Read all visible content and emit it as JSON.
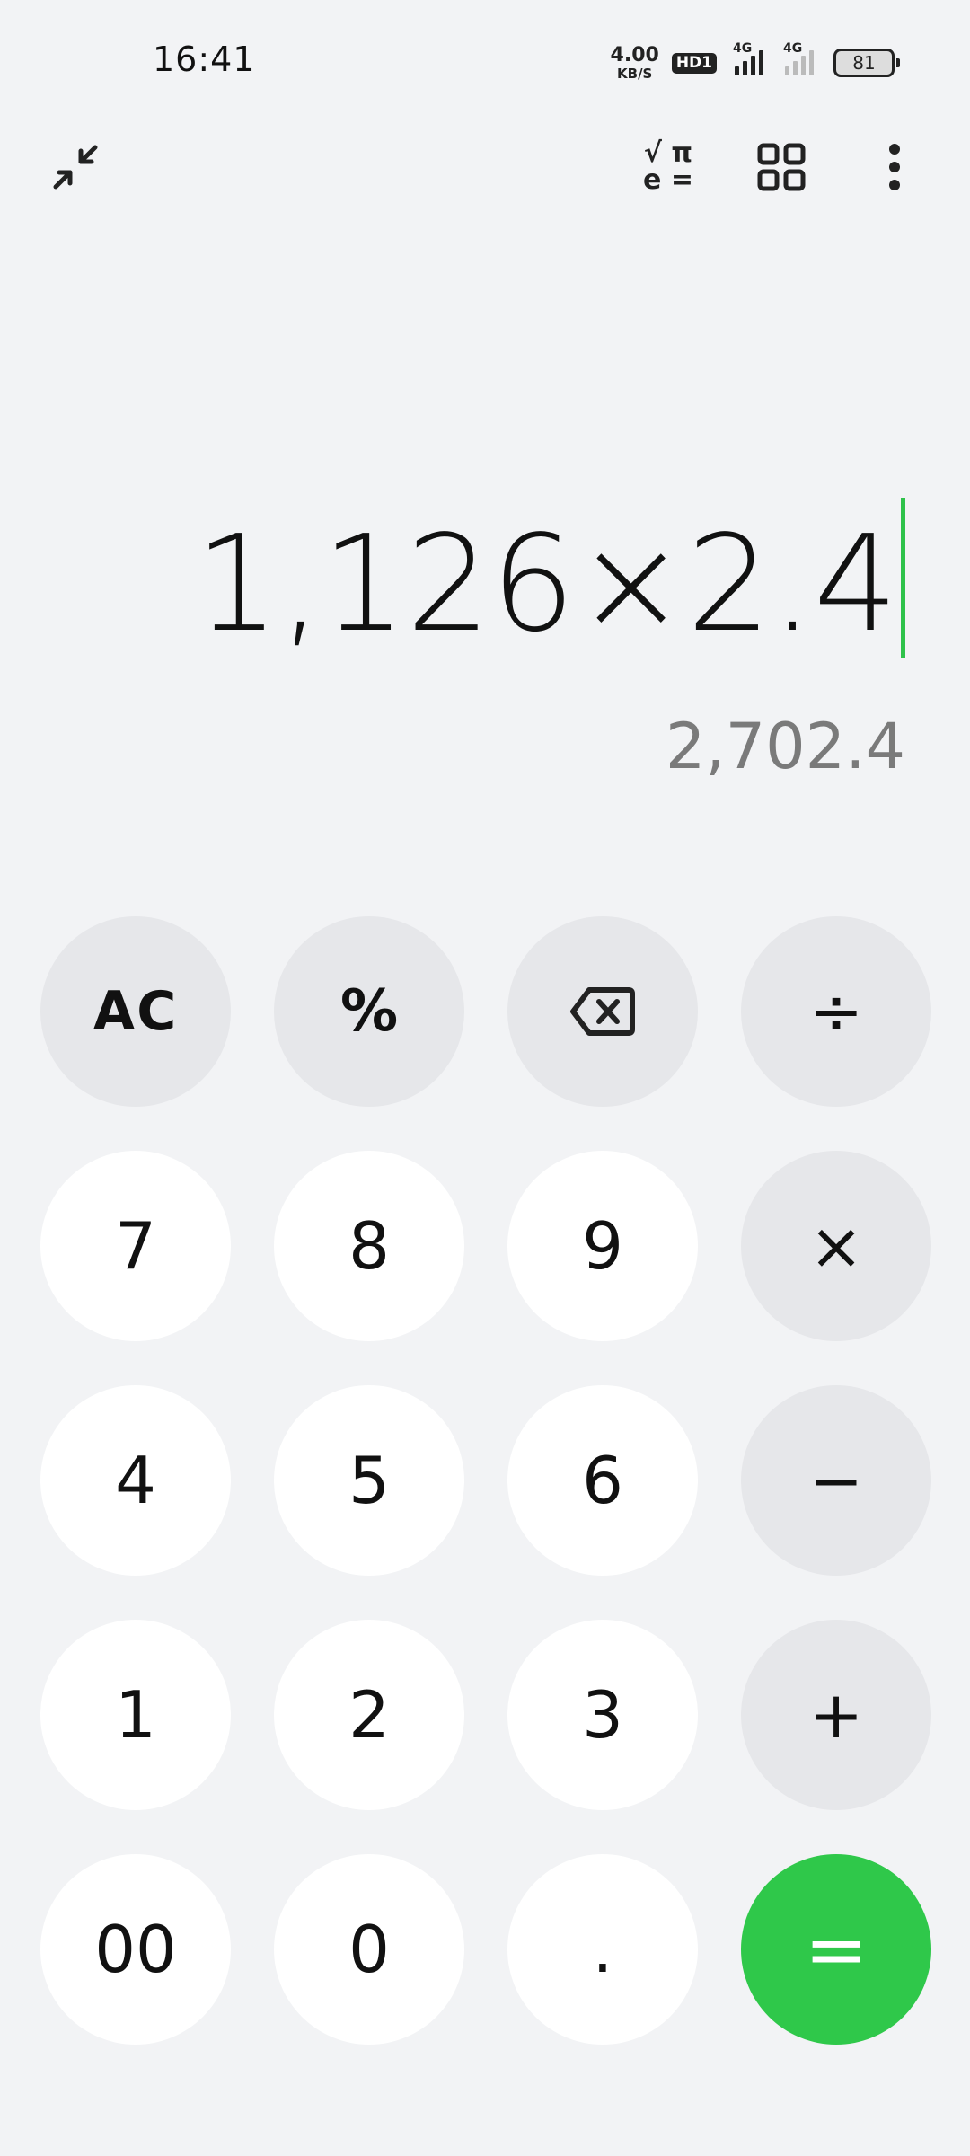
{
  "status_bar": {
    "time": "16:41",
    "net_speed_value": "4.00",
    "net_speed_unit": "KB/S",
    "hd_label": "HD1",
    "sim1_label": "4G",
    "sim2_label": "4G",
    "battery_level": "81"
  },
  "toolbar": {
    "collapse_icon": "collapse-arrows-icon",
    "scientific_icon": "scientific-functions-icon",
    "scientific_top": "√ π",
    "scientific_bottom": "e =",
    "apps_icon": "grid-icon",
    "more_icon": "more-vertical-icon"
  },
  "display": {
    "expression": "1,126×2.4",
    "result": "2,702.4"
  },
  "keypad": {
    "ac": "AC",
    "percent": "%",
    "backspace_icon": "backspace-icon",
    "divide": "÷",
    "seven": "7",
    "eight": "8",
    "nine": "9",
    "multiply": "×",
    "four": "4",
    "five": "5",
    "six": "6",
    "minus": "−",
    "one": "1",
    "two": "2",
    "three": "3",
    "plus": "+",
    "double_zero": "00",
    "zero": "0",
    "decimal": ".",
    "equals": "="
  },
  "colors": {
    "background": "#f2f3f5",
    "accent": "#2fc84a",
    "function_key": "#e6e7ea",
    "number_key": "#ffffff",
    "result_text": "#7a7a7a"
  }
}
